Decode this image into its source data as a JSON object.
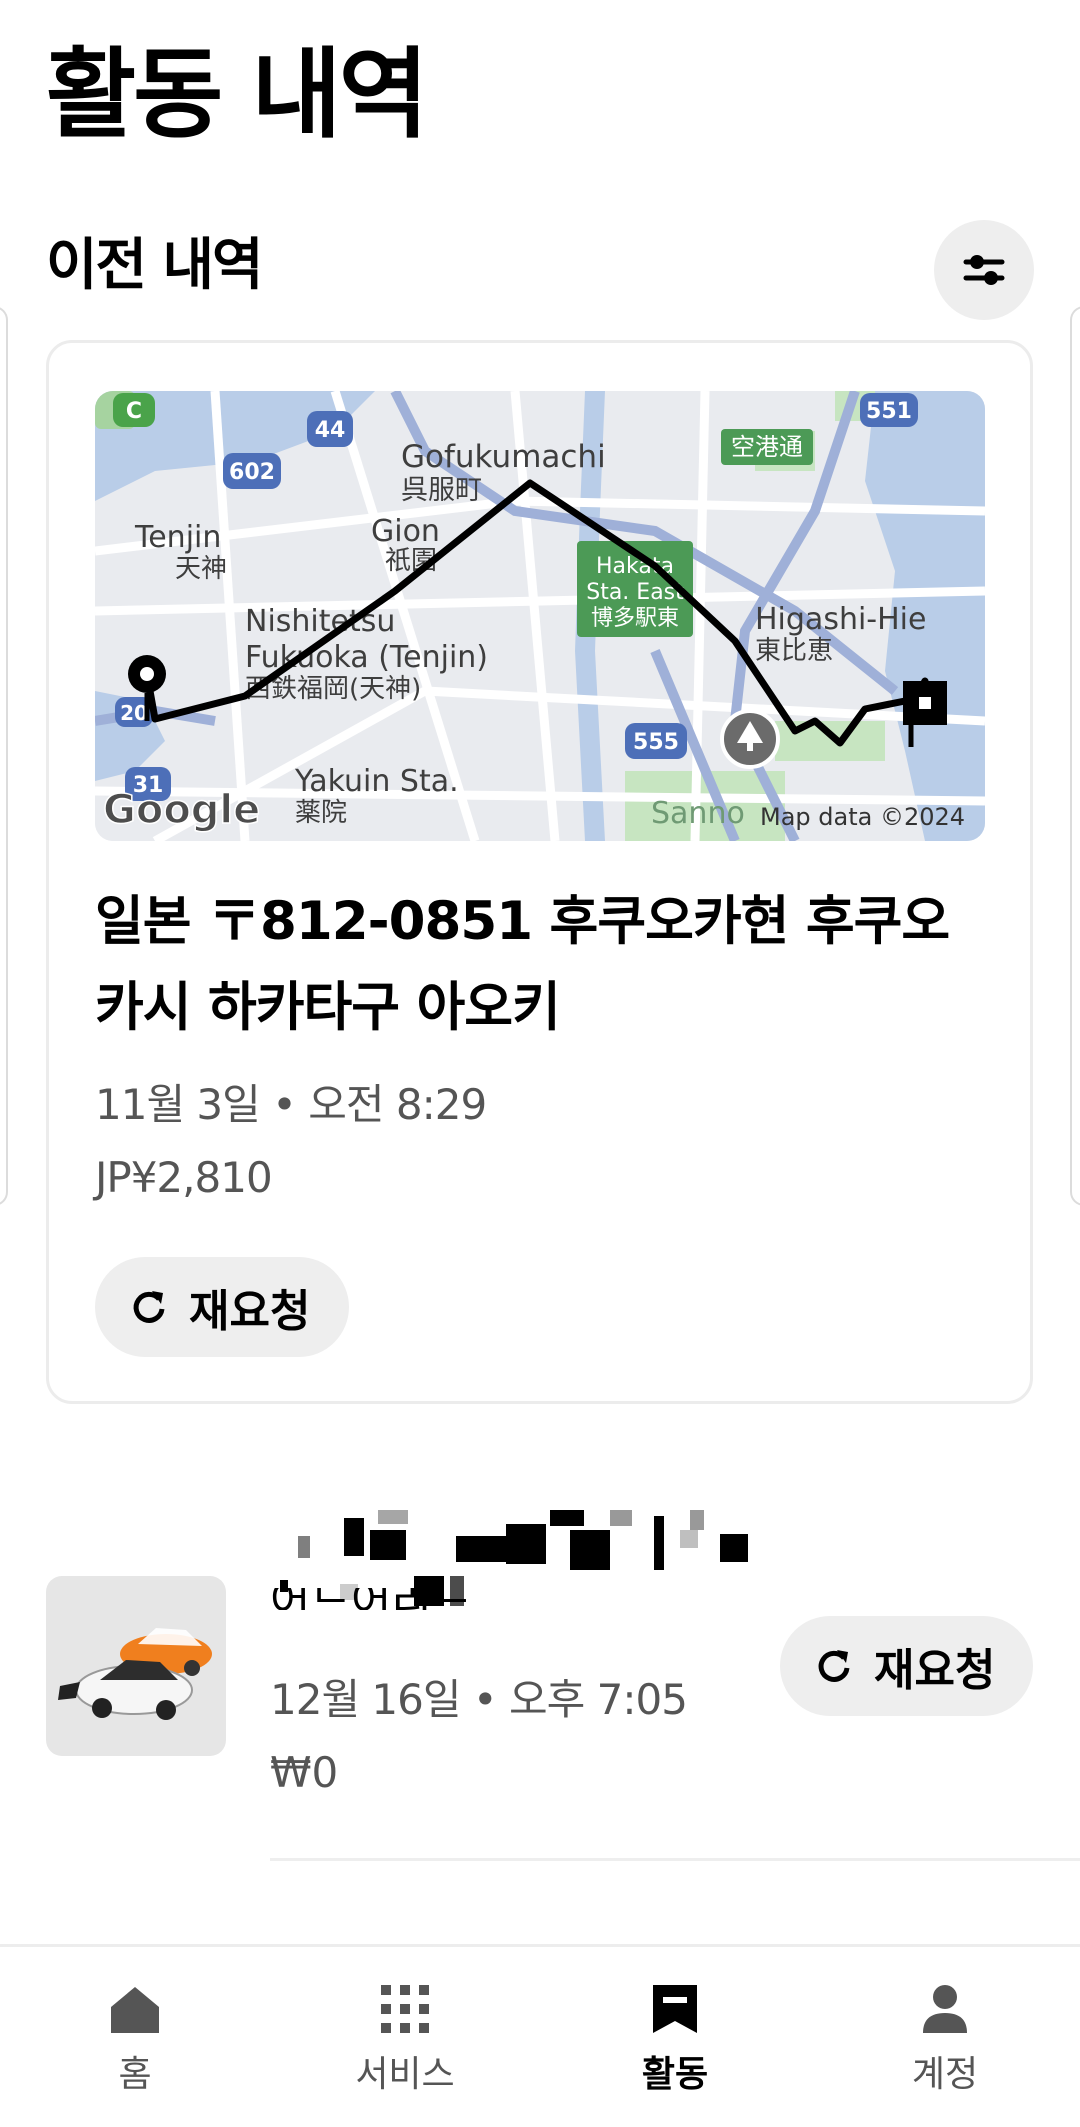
{
  "header": {
    "title": "활동 내역"
  },
  "section": {
    "title": "이전 내역"
  },
  "filter": {
    "icon": "sliders-icon"
  },
  "trip_card": {
    "map": {
      "labels": {
        "gofukumachi": "Gofukumachi",
        "gofukumachi_jp": "呉服町",
        "tenjin": "Tenjin",
        "tenjin_jp": "天神",
        "gion": "Gion",
        "gion_jp": "祇園",
        "hakata": "Hakata",
        "hakata2": "Sta. East",
        "hakata_jp": "博多駅東",
        "nishitetsu": "Nishitetsu",
        "fukuoka_tenjin": "Fukuoka (Tenjin)",
        "fukuoka_tenjin_jp": "西鉄福岡(天神)",
        "higashi_hie": "Higashi-Hie",
        "higashi_hie_jp": "東比恵",
        "yakuin": "Yakuin Sta.",
        "yakuin_jp": "薬院",
        "airport": "空港通",
        "sanno": "Sanno",
        "route_602": "602",
        "route_44": "44",
        "route_551": "551",
        "route_555": "555",
        "route_31": "31",
        "route_c": "C",
        "route_20": "20",
        "google": "Google",
        "attribution": "Map data ©2024"
      }
    },
    "address": "일본 〒812-0851 후쿠오카현 후쿠오카시 하카타구 아오키",
    "datetime": "11월 3일 • 오전 8:29",
    "price": "JP¥2,810",
    "rebook_label": "재요청"
  },
  "list_item": {
    "title_fragment": "어드어리드",
    "datetime": "12월 16일 • 오후 7:05",
    "price": "₩0",
    "rebook_label": "재요청"
  },
  "bottom_nav": {
    "items": [
      {
        "label": "홈",
        "icon": "home-icon",
        "active": false
      },
      {
        "label": "서비스",
        "icon": "grid-icon",
        "active": false
      },
      {
        "label": "활동",
        "icon": "receipt-icon",
        "active": true
      },
      {
        "label": "계정",
        "icon": "person-icon",
        "active": false
      }
    ]
  },
  "colors": {
    "accent": "#000000",
    "button_bg": "#eeeeee",
    "secondary_text": "#555555"
  }
}
